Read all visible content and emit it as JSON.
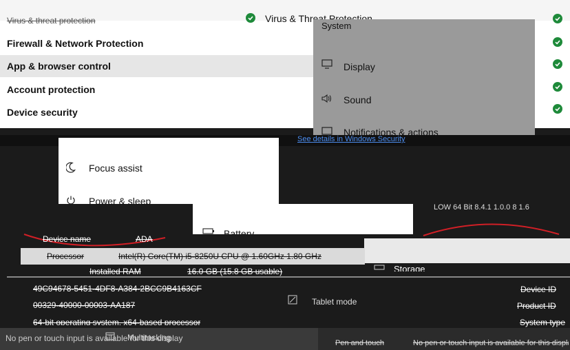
{
  "security": {
    "top_item": "Virus & Threat Protection",
    "partial_top": "Virus & threat protection",
    "items": [
      {
        "label": "Firewall & Network Protection"
      },
      {
        "label": "App & browser control"
      },
      {
        "label": "Account protection"
      },
      {
        "label": "Device security"
      }
    ],
    "link": "See details in Windows Security"
  },
  "settings_menu": {
    "title": "System",
    "items": [
      {
        "label": "Display",
        "icon": "monitor-icon"
      },
      {
        "label": "Sound",
        "icon": "speaker-icon"
      },
      {
        "label": "Notifications & actions",
        "icon": "notification-icon"
      },
      {
        "label": "Focus assist",
        "icon": "moon-icon"
      },
      {
        "label": "Power & sleep",
        "icon": "power-icon"
      },
      {
        "label": "Battery",
        "icon": "battery-icon"
      },
      {
        "label": "Storage",
        "icon": "storage-icon"
      },
      {
        "label": "Tablet mode",
        "icon": "tablet-icon"
      },
      {
        "label": "Multitasking",
        "icon": "multitask-icon"
      }
    ]
  },
  "device_specs": {
    "device_name_label": "Device name",
    "device_name_value": "ADA",
    "processor_label": "Processor",
    "processor_value": "Intel(R) Core(TM) i5-8250U CPU @ 1.60GHz 1.80 GHz",
    "ram_label": "Installed RAM",
    "ram_value": "16.0 GB (15.8 GB usable)",
    "device_id": "49C94678-5451-4DF8-A384-2BCC9B4163CF",
    "product_id": "00329-40000-00003-AA187",
    "system_type": "64-bit operating system, x64-based processor",
    "pen_label": "Pen and touch",
    "pen_value": "No pen or touch input is available for this display",
    "right_labels": [
      "Device ID",
      "Product ID",
      "System type"
    ],
    "top_right": "LOW 64 Bit 8.4.1    1.0.0 8 1.6"
  },
  "colors": {
    "accent_green": "#1e8a3a",
    "annotation_red": "#d11f26"
  }
}
